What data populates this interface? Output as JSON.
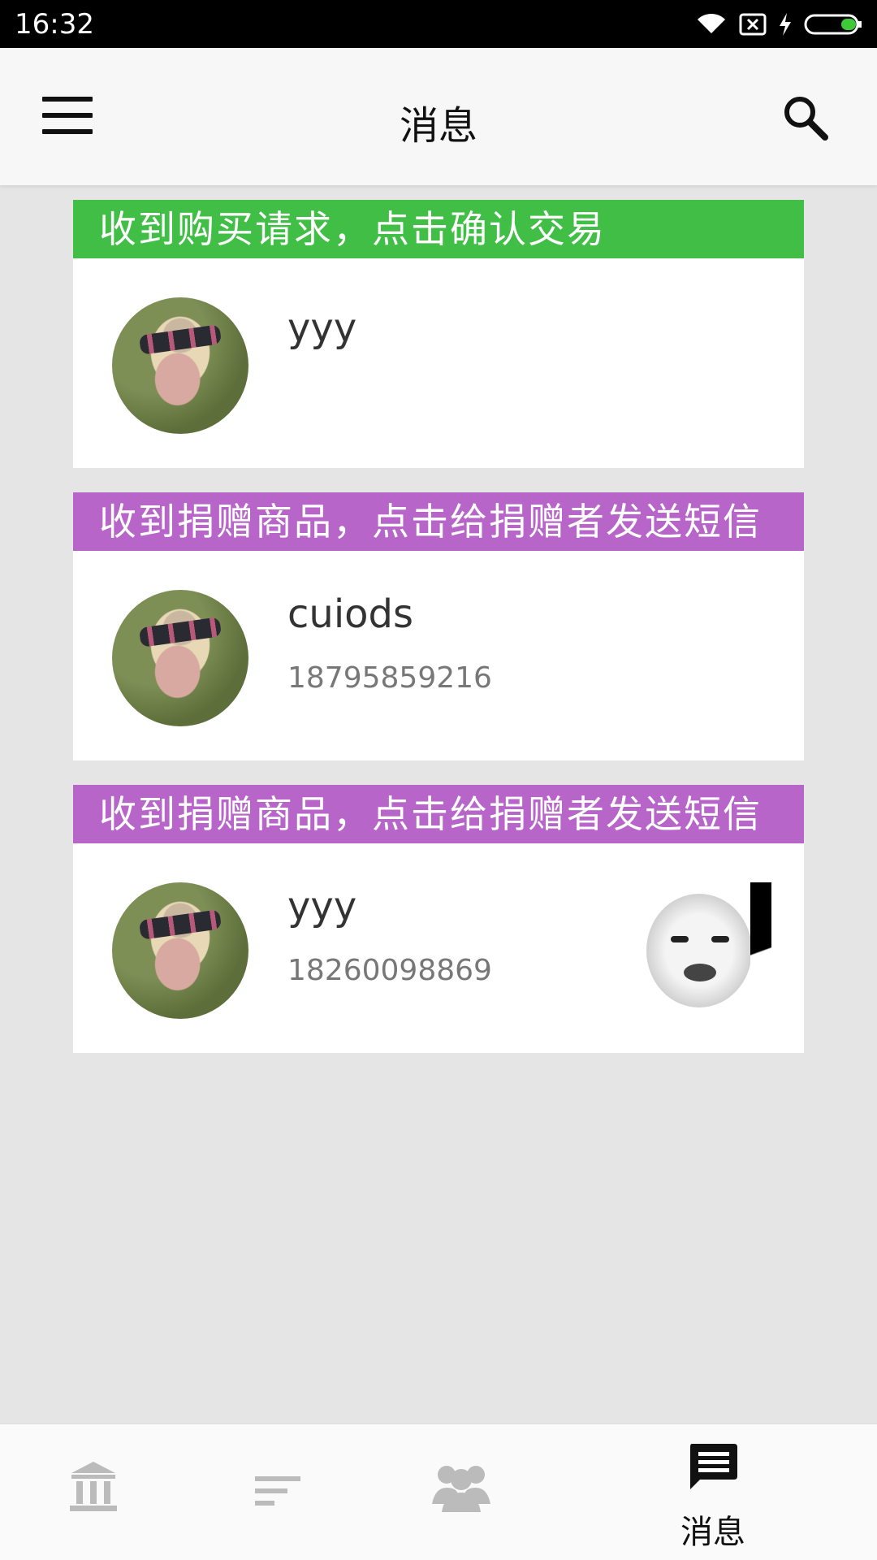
{
  "status_bar": {
    "time": "16:32",
    "icons": [
      "wifi-icon",
      "sim-off-icon",
      "charging-icon",
      "battery-icon"
    ]
  },
  "app_bar": {
    "title": "消息",
    "menu_icon": "menu-icon",
    "search_icon": "search-icon"
  },
  "colors": {
    "green_banner": "#41be45",
    "purple_banner": "#b765c8"
  },
  "messages": [
    {
      "banner": "收到购买请求，点击确认交易",
      "banner_color": "#41be45",
      "username": "yyy",
      "phone": ""
    },
    {
      "banner": "收到捐赠商品，点击给捐赠者发送短信",
      "banner_color": "#b765c8",
      "username": "cuiods",
      "phone": "18795859216"
    },
    {
      "banner": "收到捐赠商品，点击给捐赠者发送短信",
      "banner_color": "#b765c8",
      "username": "yyy",
      "phone": "18260098869"
    }
  ],
  "bottom_nav": {
    "items": [
      {
        "icon": "bank-icon",
        "label": ""
      },
      {
        "icon": "sort-icon",
        "label": ""
      },
      {
        "icon": "people-icon",
        "label": ""
      },
      {
        "icon": "message-icon",
        "label": "消息"
      }
    ]
  }
}
